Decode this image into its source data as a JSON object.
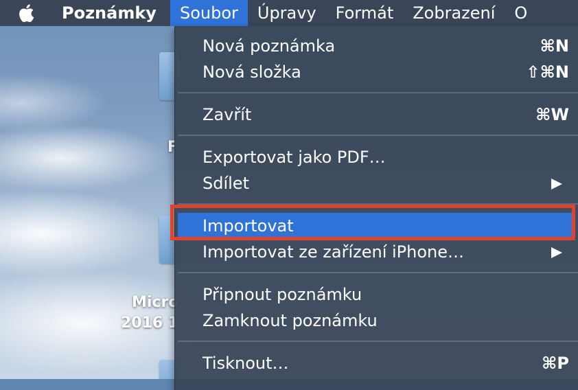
{
  "menubar": {
    "apple_icon": "apple-logo-icon",
    "app_name": "Poznámky",
    "items": [
      "Soubor",
      "Úpravy",
      "Formát",
      "Zobrazení",
      "O"
    ]
  },
  "desktop": {
    "label_line1": "Micro",
    "label_line2": "2016 1",
    "partial_label": "F"
  },
  "file_menu": {
    "items": [
      {
        "label": "Nová poznámka",
        "shortcut": "⌘N"
      },
      {
        "label": "Nová složka",
        "shortcut": "⇧⌘N"
      },
      {
        "label": "Zavřít",
        "shortcut": "⌘W"
      },
      {
        "label": "Exportovat jako PDF…",
        "shortcut": ""
      },
      {
        "label": "Sdílet",
        "submenu": true
      },
      {
        "label": "Importovat",
        "highlighted": true
      },
      {
        "label": "Importovat ze zařízení iPhone…",
        "submenu": true
      },
      {
        "label": "Připnout poznámku",
        "shortcut": ""
      },
      {
        "label": "Zamknout poznámku",
        "shortcut": ""
      },
      {
        "label": "Tisknout…",
        "shortcut": "⌘P"
      }
    ]
  },
  "colors": {
    "menubar_bg": "#3a4658",
    "active_menu_bg": "#2f73d8",
    "annotation_border": "#e0432d"
  }
}
